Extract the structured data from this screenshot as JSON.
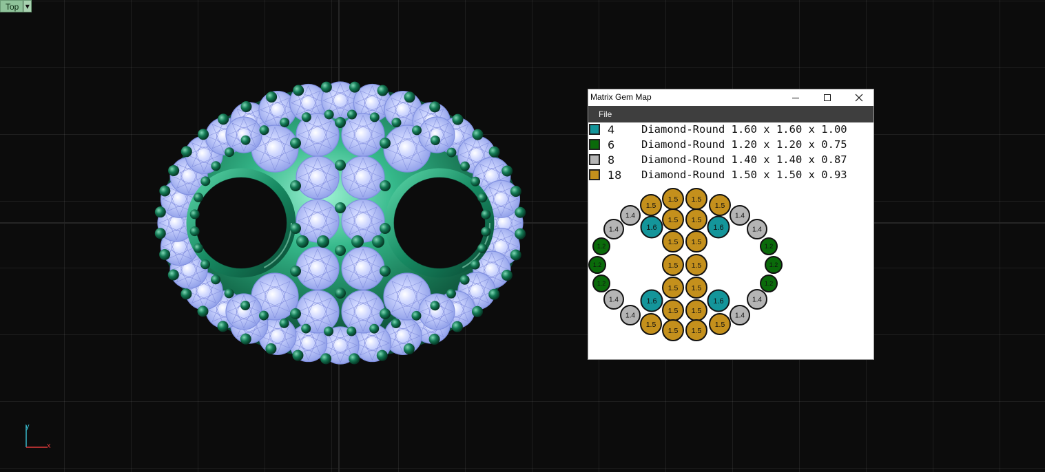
{
  "viewport": {
    "view_label": "Top",
    "view_dropdown_icon": "triangle-down-icon",
    "axis_labels": {
      "y": "y",
      "x": "x"
    },
    "colors": {
      "metal": "#1d8a66",
      "metal_dark": "#0b4a35",
      "prong": "#0f6a4c",
      "gem": "#b9c4ff",
      "gem_edge": "#8090e0"
    }
  },
  "gem_map": {
    "title": "Matrix Gem Map",
    "controls": {
      "minimize": "minimize-icon",
      "maximize": "maximize-icon",
      "close": "close-icon"
    },
    "menu": [
      {
        "label": "File"
      }
    ],
    "legend": [
      {
        "count": "4",
        "description": "Diamond-Round 1.60 x 1.60 x 1.00",
        "color": "#14959a"
      },
      {
        "count": "6",
        "description": "Diamond-Round 1.20 x 1.20 x 0.75",
        "color": "#0a6a0a"
      },
      {
        "count": "8",
        "description": "Diamond-Round 1.40 x 1.40 x 0.87",
        "color": "#b4b4b4"
      },
      {
        "count": "18",
        "description": "Diamond-Round 1.50 x 1.50 x 0.93",
        "color": "#c4901c"
      }
    ],
    "sizes": {
      "s16": "1.6",
      "s12": "1.2",
      "s14": "1.4",
      "s15": "1.5"
    }
  }
}
